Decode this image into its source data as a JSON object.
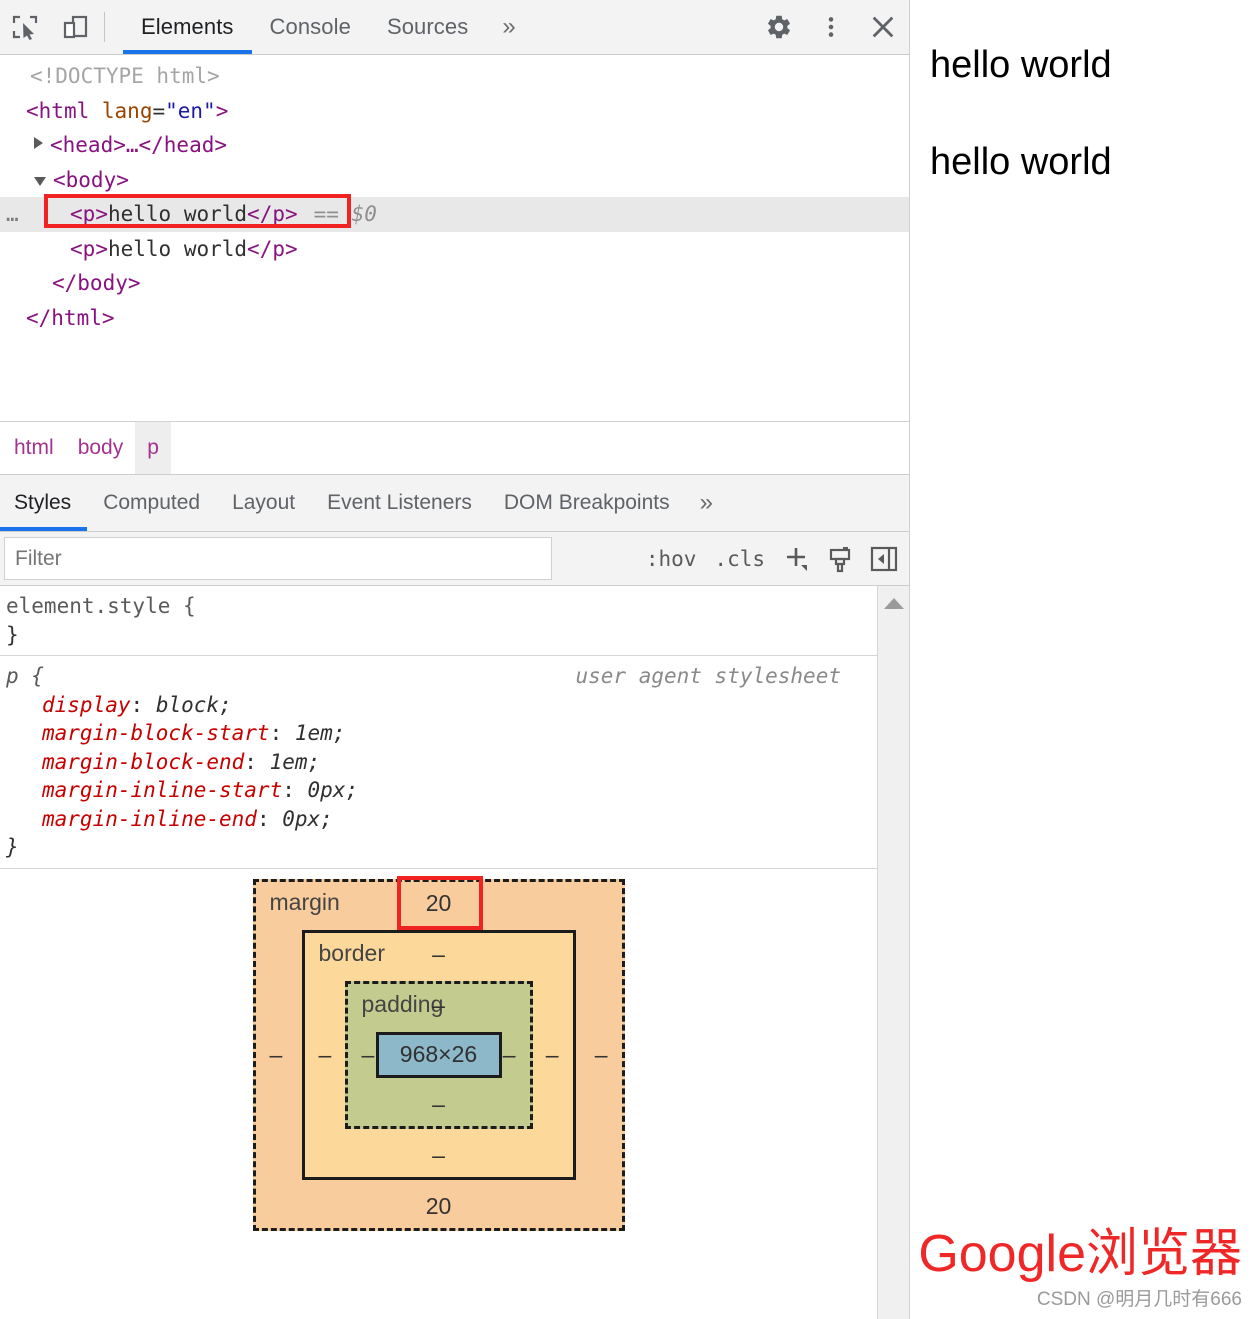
{
  "toolbar": {
    "inspect_icon": "inspect-element-icon",
    "device_icon": "device-toolbar-icon",
    "tabs": [
      {
        "label": "Elements",
        "active": true
      },
      {
        "label": "Console",
        "active": false
      },
      {
        "label": "Sources",
        "active": false
      }
    ],
    "more_tabs": "»",
    "settings_icon": "gear-icon",
    "kebab_icon": "more-vertical-icon",
    "close_icon": "close-icon",
    "accent_color": "#1a73e8"
  },
  "dom_tree": {
    "rows": [
      {
        "kind": "doctype",
        "text": "<!DOCTYPE html>"
      },
      {
        "kind": "open",
        "tag": "html",
        "attr": "lang",
        "value": "\"en\""
      },
      {
        "kind": "collapsed",
        "tag": "head",
        "text": "<head>…</head>"
      },
      {
        "kind": "open",
        "tag": "body",
        "text": "<body>"
      },
      {
        "kind": "element",
        "text": "<p>hello world</p>",
        "inner": "hello world",
        "tag": "p",
        "suffix": "== $0",
        "selected": true
      },
      {
        "kind": "element",
        "text": "<p>hello world</p>",
        "inner": "hello world",
        "tag": "p",
        "selected": false
      },
      {
        "kind": "close",
        "text": "</body>"
      },
      {
        "kind": "close",
        "text": "</html>"
      }
    ],
    "ellipsis_menu": "…",
    "selected_suffix": "== $0",
    "highlight_color": "#f02222"
  },
  "breadcrumb": {
    "items": [
      {
        "label": "html",
        "active": false
      },
      {
        "label": "body",
        "active": false
      },
      {
        "label": "p",
        "active": true
      }
    ]
  },
  "sidebar_tabs": {
    "tabs": [
      {
        "label": "Styles",
        "active": true
      },
      {
        "label": "Computed",
        "active": false
      },
      {
        "label": "Layout",
        "active": false
      },
      {
        "label": "Event Listeners",
        "active": false
      },
      {
        "label": "DOM Breakpoints",
        "active": false
      }
    ],
    "more": "»"
  },
  "filter_bar": {
    "placeholder": "Filter",
    "value": "",
    "hov_label": ":hov",
    "cls_label": ".cls",
    "new_rule_icon": "plus-icon",
    "brush_icon": "paintbrush-icon",
    "sidebar_toggle_icon": "toggle-sidebar-icon"
  },
  "styles": {
    "rules": [
      {
        "selector": "element.style {",
        "origin": "",
        "declarations": [],
        "close": "}"
      },
      {
        "selector": "p {",
        "origin": "user agent stylesheet",
        "declarations": [
          {
            "prop": "display",
            "value": "block;"
          },
          {
            "prop": "margin-block-start",
            "value": "1em;"
          },
          {
            "prop": "margin-block-end",
            "value": "1em;"
          },
          {
            "prop": "margin-inline-start",
            "value": "0px;"
          },
          {
            "prop": "margin-inline-end",
            "value": "0px;"
          }
        ],
        "close": "}"
      }
    ]
  },
  "box_model": {
    "margin": {
      "label": "margin",
      "top": "20",
      "right": "–",
      "bottom": "20",
      "left": "–",
      "color": "#f9cc9d"
    },
    "border": {
      "label": "border",
      "top": "–",
      "right": "–",
      "bottom": "–",
      "left": "–",
      "color": "#fcd89b"
    },
    "padding": {
      "label": "padding",
      "top": "–",
      "right": "–",
      "bottom": "–",
      "left": "–",
      "color": "#c3cc8e"
    },
    "content": {
      "size": "968×26",
      "color": "#8cb8ca"
    },
    "highlight_color": "#f02222"
  },
  "page_view": {
    "paragraphs": [
      "hello world",
      "hello world"
    ]
  },
  "watermark": {
    "title": "Google浏览器",
    "credit": "CSDN @明月几时有666",
    "title_color": "#f02727"
  }
}
